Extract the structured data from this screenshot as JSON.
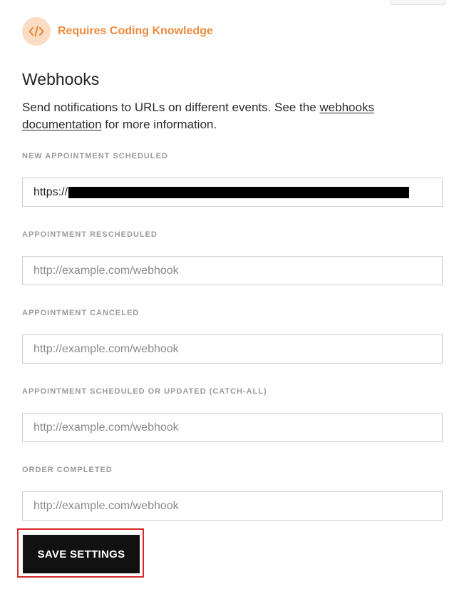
{
  "badge": {
    "icon": "code-icon",
    "label": "Requires Coding Knowledge",
    "color": "#ef8a3c",
    "icon_bg": "#f9dcc3"
  },
  "section": {
    "title": "Webhooks",
    "description_before": "Send notifications to URLs on different events. See the ",
    "link_text": "webhooks documentation",
    "description_after": " for more information."
  },
  "fields": [
    {
      "label": "NEW APPOINTMENT SCHEDULED",
      "value": "https://",
      "redacted": true,
      "placeholder": "http://example.com/webhook"
    },
    {
      "label": "APPOINTMENT RESCHEDULED",
      "value": "",
      "placeholder": "http://example.com/webhook"
    },
    {
      "label": "APPOINTMENT CANCELED",
      "value": "",
      "placeholder": "http://example.com/webhook"
    },
    {
      "label": "APPOINTMENT SCHEDULED OR UPDATED (CATCH-ALL)",
      "value": "",
      "placeholder": "http://example.com/webhook"
    },
    {
      "label": "ORDER COMPLETED",
      "value": "",
      "placeholder": "http://example.com/webhook"
    }
  ],
  "actions": {
    "save_label": "SAVE SETTINGS",
    "highlight_color": "#d62828"
  }
}
